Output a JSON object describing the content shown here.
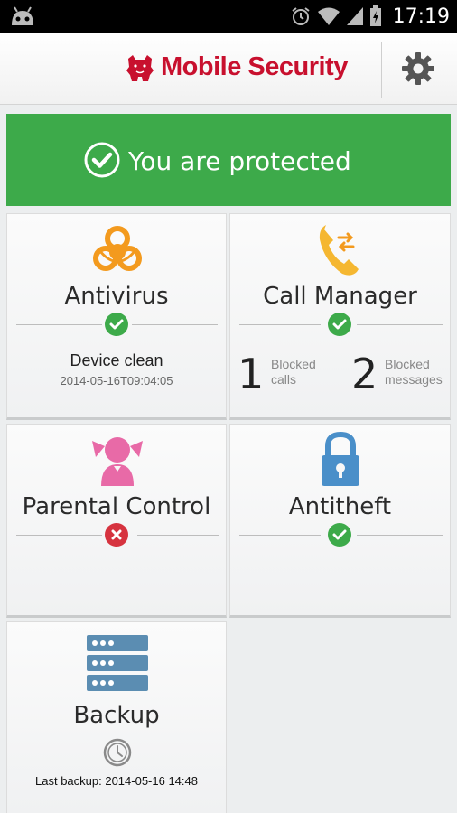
{
  "status_bar": {
    "time": "17:19",
    "icons": [
      "android-icon",
      "alarm-icon",
      "wifi-icon",
      "signal-icon",
      "battery-icon"
    ]
  },
  "header": {
    "brand_name": "Mobile Security",
    "brand_color": "#c8102e",
    "logo_icon": "bulldog-logo-icon",
    "settings_icon": "gear-icon"
  },
  "banner": {
    "text": "You are protected",
    "color": "#3daa4a",
    "icon": "check-circle-icon"
  },
  "tiles": {
    "antivirus": {
      "title": "Antivirus",
      "icon": "biohazard-icon",
      "status": "ok",
      "line1": "Device clean",
      "line2": "2014-05-16T09:04:05"
    },
    "call_manager": {
      "title": "Call Manager",
      "icon": "phone-transfer-icon",
      "status": "ok",
      "blocked_calls_count": "1",
      "blocked_calls_label_1": "Blocked",
      "blocked_calls_label_2": "calls",
      "blocked_messages_count": "2",
      "blocked_messages_label_1": "Blocked",
      "blocked_messages_label_2": "messages"
    },
    "parental_control": {
      "title": "Parental Control",
      "icon": "child-icon",
      "status": "error"
    },
    "antitheft": {
      "title": "Antitheft",
      "icon": "padlock-icon",
      "status": "ok"
    },
    "backup": {
      "title": "Backup",
      "icon": "server-stack-icon",
      "status": "clock",
      "last_backup": "Last backup: 2014-05-16 14:48"
    }
  }
}
